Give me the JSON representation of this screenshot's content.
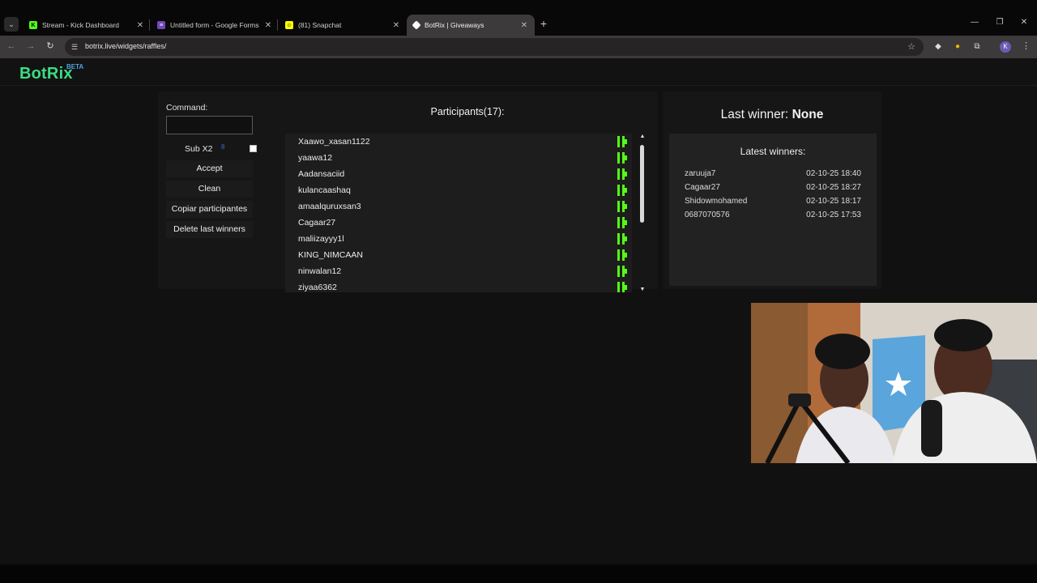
{
  "browser": {
    "tabs": [
      {
        "title": "Stream - Kick Dashboard",
        "favicon": "kick-icon",
        "active": false
      },
      {
        "title": "Untitled form - Google Forms",
        "favicon": "forms-icon",
        "active": false
      },
      {
        "title": "(81) Snapchat",
        "favicon": "snapchat-icon",
        "active": false
      },
      {
        "title": "BotRix | Giveaways",
        "favicon": "botrix-icon",
        "active": true
      }
    ],
    "url": "botrix.live/widgets/raffles/",
    "profile_initial": "K"
  },
  "app": {
    "logo": "BotRix",
    "badge": "BETA"
  },
  "controls": {
    "command_label": "Command:",
    "command_value": "",
    "sub_label": "Sub X2",
    "sub_value": "8",
    "accept_label": "Accept",
    "clean_label": "Clean",
    "copy_label": "Copiar participantes",
    "delete_label": "Delete last winners"
  },
  "participants": {
    "title": "Participants(17):",
    "items": [
      "Xaawo_xasan1122",
      "yaawa12",
      "Aadansaciid",
      "kulancaashaq",
      "amaalquruxsan3",
      "Cagaar27",
      "maliizayyy1l",
      "KING_NIMCAAN",
      "ninwalan12",
      "ziyaa6362"
    ]
  },
  "winners": {
    "last_winner_label": "Last winner:",
    "last_winner_value": "None",
    "latest_title": "Latest winners:",
    "list": [
      {
        "name": "zaruuja7",
        "date": "02-10-25 18:40"
      },
      {
        "name": "Cagaar27",
        "date": "02-10-25 18:27"
      },
      {
        "name": "Shidowmohamed",
        "date": "02-10-25 18:17"
      },
      {
        "name": "0687070576",
        "date": "02-10-25 17:53"
      }
    ]
  },
  "colors": {
    "brand": "#3ddc84",
    "kick_green": "#53fc18",
    "beta_blue": "#4fa3e0"
  }
}
